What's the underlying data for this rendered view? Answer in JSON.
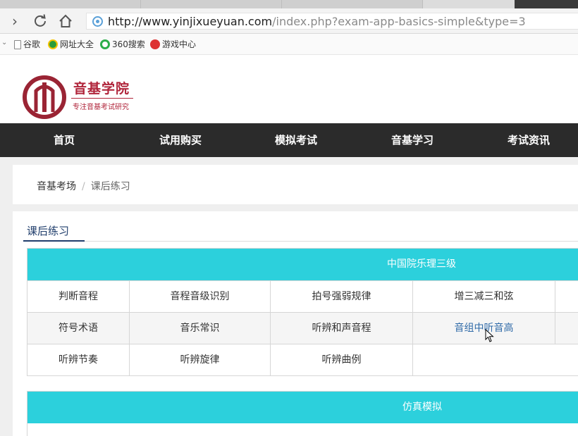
{
  "browser": {
    "url_host": "http://www.yinjixueyuan.com",
    "url_path": "/index.php?exam-app-basics-simple&type=3",
    "bookmarks": [
      "谷歌",
      "网址大全",
      "360搜索",
      "游戏中心"
    ]
  },
  "site": {
    "brand_name": "音基学院",
    "brand_subtitle": "专注音基考试研究",
    "nav": [
      "首页",
      "试用购买",
      "模拟考试",
      "音基学习",
      "考试资讯"
    ]
  },
  "breadcrumb": {
    "root": "音基考场",
    "separator": "/",
    "current": "课后练习"
  },
  "section": {
    "title": "课后练习"
  },
  "table1": {
    "header": "中国院乐理三级",
    "rows": [
      [
        "判断音程",
        "音程音级识别",
        "拍号强弱规律",
        "增三减三和弦"
      ],
      [
        "符号术语",
        "音乐常识",
        "听辨和声音程",
        "音组中听音高"
      ],
      [
        "听辨节奏",
        "听辨旋律",
        "听辨曲例",
        ""
      ]
    ]
  },
  "table2": {
    "header": "仿真模拟"
  },
  "colors": {
    "accent_cyan": "#2cd0dc",
    "brand_red": "#b0243a",
    "nav_dark": "#2b2b2b",
    "link_blue": "#2f6aa8"
  }
}
